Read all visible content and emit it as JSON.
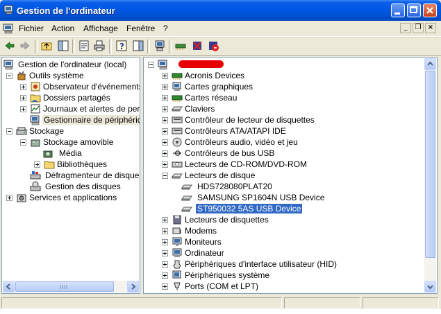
{
  "window": {
    "title": "Gestion de l'ordinateur",
    "titlebar_color": "#0058e6",
    "controls": [
      "minimize-icon",
      "maximize-icon",
      "close-icon"
    ]
  },
  "menu": {
    "items": [
      "Fichier",
      "Action",
      "Affichage",
      "Fenêtre",
      "?"
    ]
  },
  "toolbar": {
    "buttons": [
      "back-icon",
      "forward-icon",
      "up-folder-icon",
      "show-hide-tree-icon",
      "properties-icon",
      "print-icon",
      "help-icon",
      "show-hide-action-pane-icon",
      "scan-hardware-icon",
      "update-driver-icon",
      "disable-device-icon",
      "uninstall-device-icon"
    ]
  },
  "tree": {
    "root": "Gestion de l'ordinateur (local)",
    "outils": "Outils système",
    "observateur": "Observateur d'événements",
    "dossiers": "Dossiers partagés",
    "journaux": "Journaux et alertes de perfo",
    "gestionnaire": "Gestionnaire de périphérique",
    "stockage": "Stockage",
    "stockage_amovible": "Stockage amovible",
    "media": "Média",
    "bibliotheques": "Bibliothèques",
    "defrag": "Défragmenteur de disque",
    "gestion_disques": "Gestion des disques",
    "services": "Services et applications"
  },
  "devices": {
    "items": [
      "Acronis Devices",
      "Cartes graphiques",
      "Cartes réseau",
      "Claviers",
      "Contrôleur de lecteur de disquettes",
      "Contrôleurs ATA/ATAPI IDE",
      "Contrôleurs audio, vidéo et jeu",
      "Contrôleurs de bus USB",
      "Lecteurs de CD-ROM/DVD-ROM",
      "Lecteurs de disque",
      "HDS728080PLAT20",
      "SAMSUNG SP1604N USB Device",
      "ST950032 5AS USB Device",
      "Lecteurs de disquettes",
      "Modems",
      "Moniteurs",
      "Ordinateur",
      "Périphériques d'interface utilisateur (HID)",
      "Périphériques système",
      "Ports (COM et LPT)"
    ],
    "selected": "ST950032 5AS USB Device",
    "selection_color": "#316ac5"
  }
}
